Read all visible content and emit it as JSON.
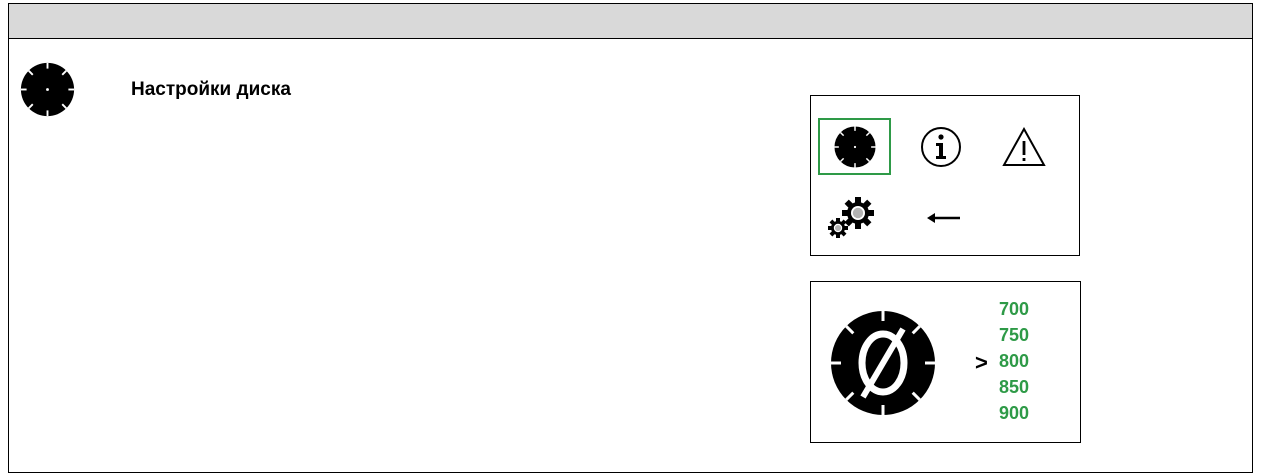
{
  "header": {
    "title": "Настройки диска"
  },
  "menu": {
    "items": [
      {
        "name": "disc",
        "icon": "saw-blade-icon",
        "selected": true
      },
      {
        "name": "info",
        "icon": "info-icon",
        "selected": false
      },
      {
        "name": "warning",
        "icon": "warning-icon",
        "selected": false
      },
      {
        "name": "settings",
        "icon": "gears-icon",
        "selected": false
      },
      {
        "name": "back",
        "icon": "back-arrow-icon",
        "selected": false
      }
    ]
  },
  "diameter": {
    "icon": "blade-diameter-icon",
    "cursor": ">",
    "options": [
      "700",
      "750",
      "800",
      "850",
      "900"
    ],
    "selected": "800"
  },
  "colors": {
    "accent": "#2e9a47",
    "header_bg": "#d9d9d9"
  }
}
